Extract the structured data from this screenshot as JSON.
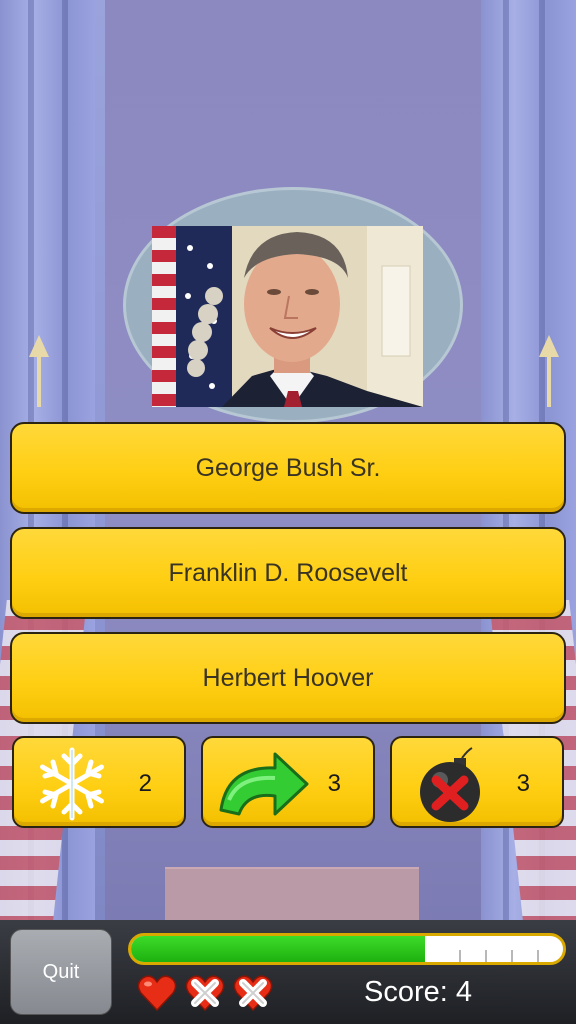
{
  "question": {
    "image": "president-portrait"
  },
  "answers": [
    {
      "label": "George Bush Sr."
    },
    {
      "label": "Franklin D. Roosevelt"
    },
    {
      "label": "Herbert Hoover"
    }
  ],
  "powerups": [
    {
      "icon": "snowflake-icon",
      "count": "2"
    },
    {
      "icon": "skip-arrow-icon",
      "count": "3"
    },
    {
      "icon": "bomb-icon",
      "count": "3"
    }
  ],
  "footer": {
    "quit_label": "Quit",
    "progress_fraction": 0.68,
    "lives": [
      "heart-icon",
      "lost-life-icon",
      "lost-life-icon"
    ],
    "score_label": "Score:",
    "score_value": "4",
    "colors": {
      "progress": "#1eb10f",
      "button": "#ffcf14",
      "heart": "#e82d16"
    }
  }
}
